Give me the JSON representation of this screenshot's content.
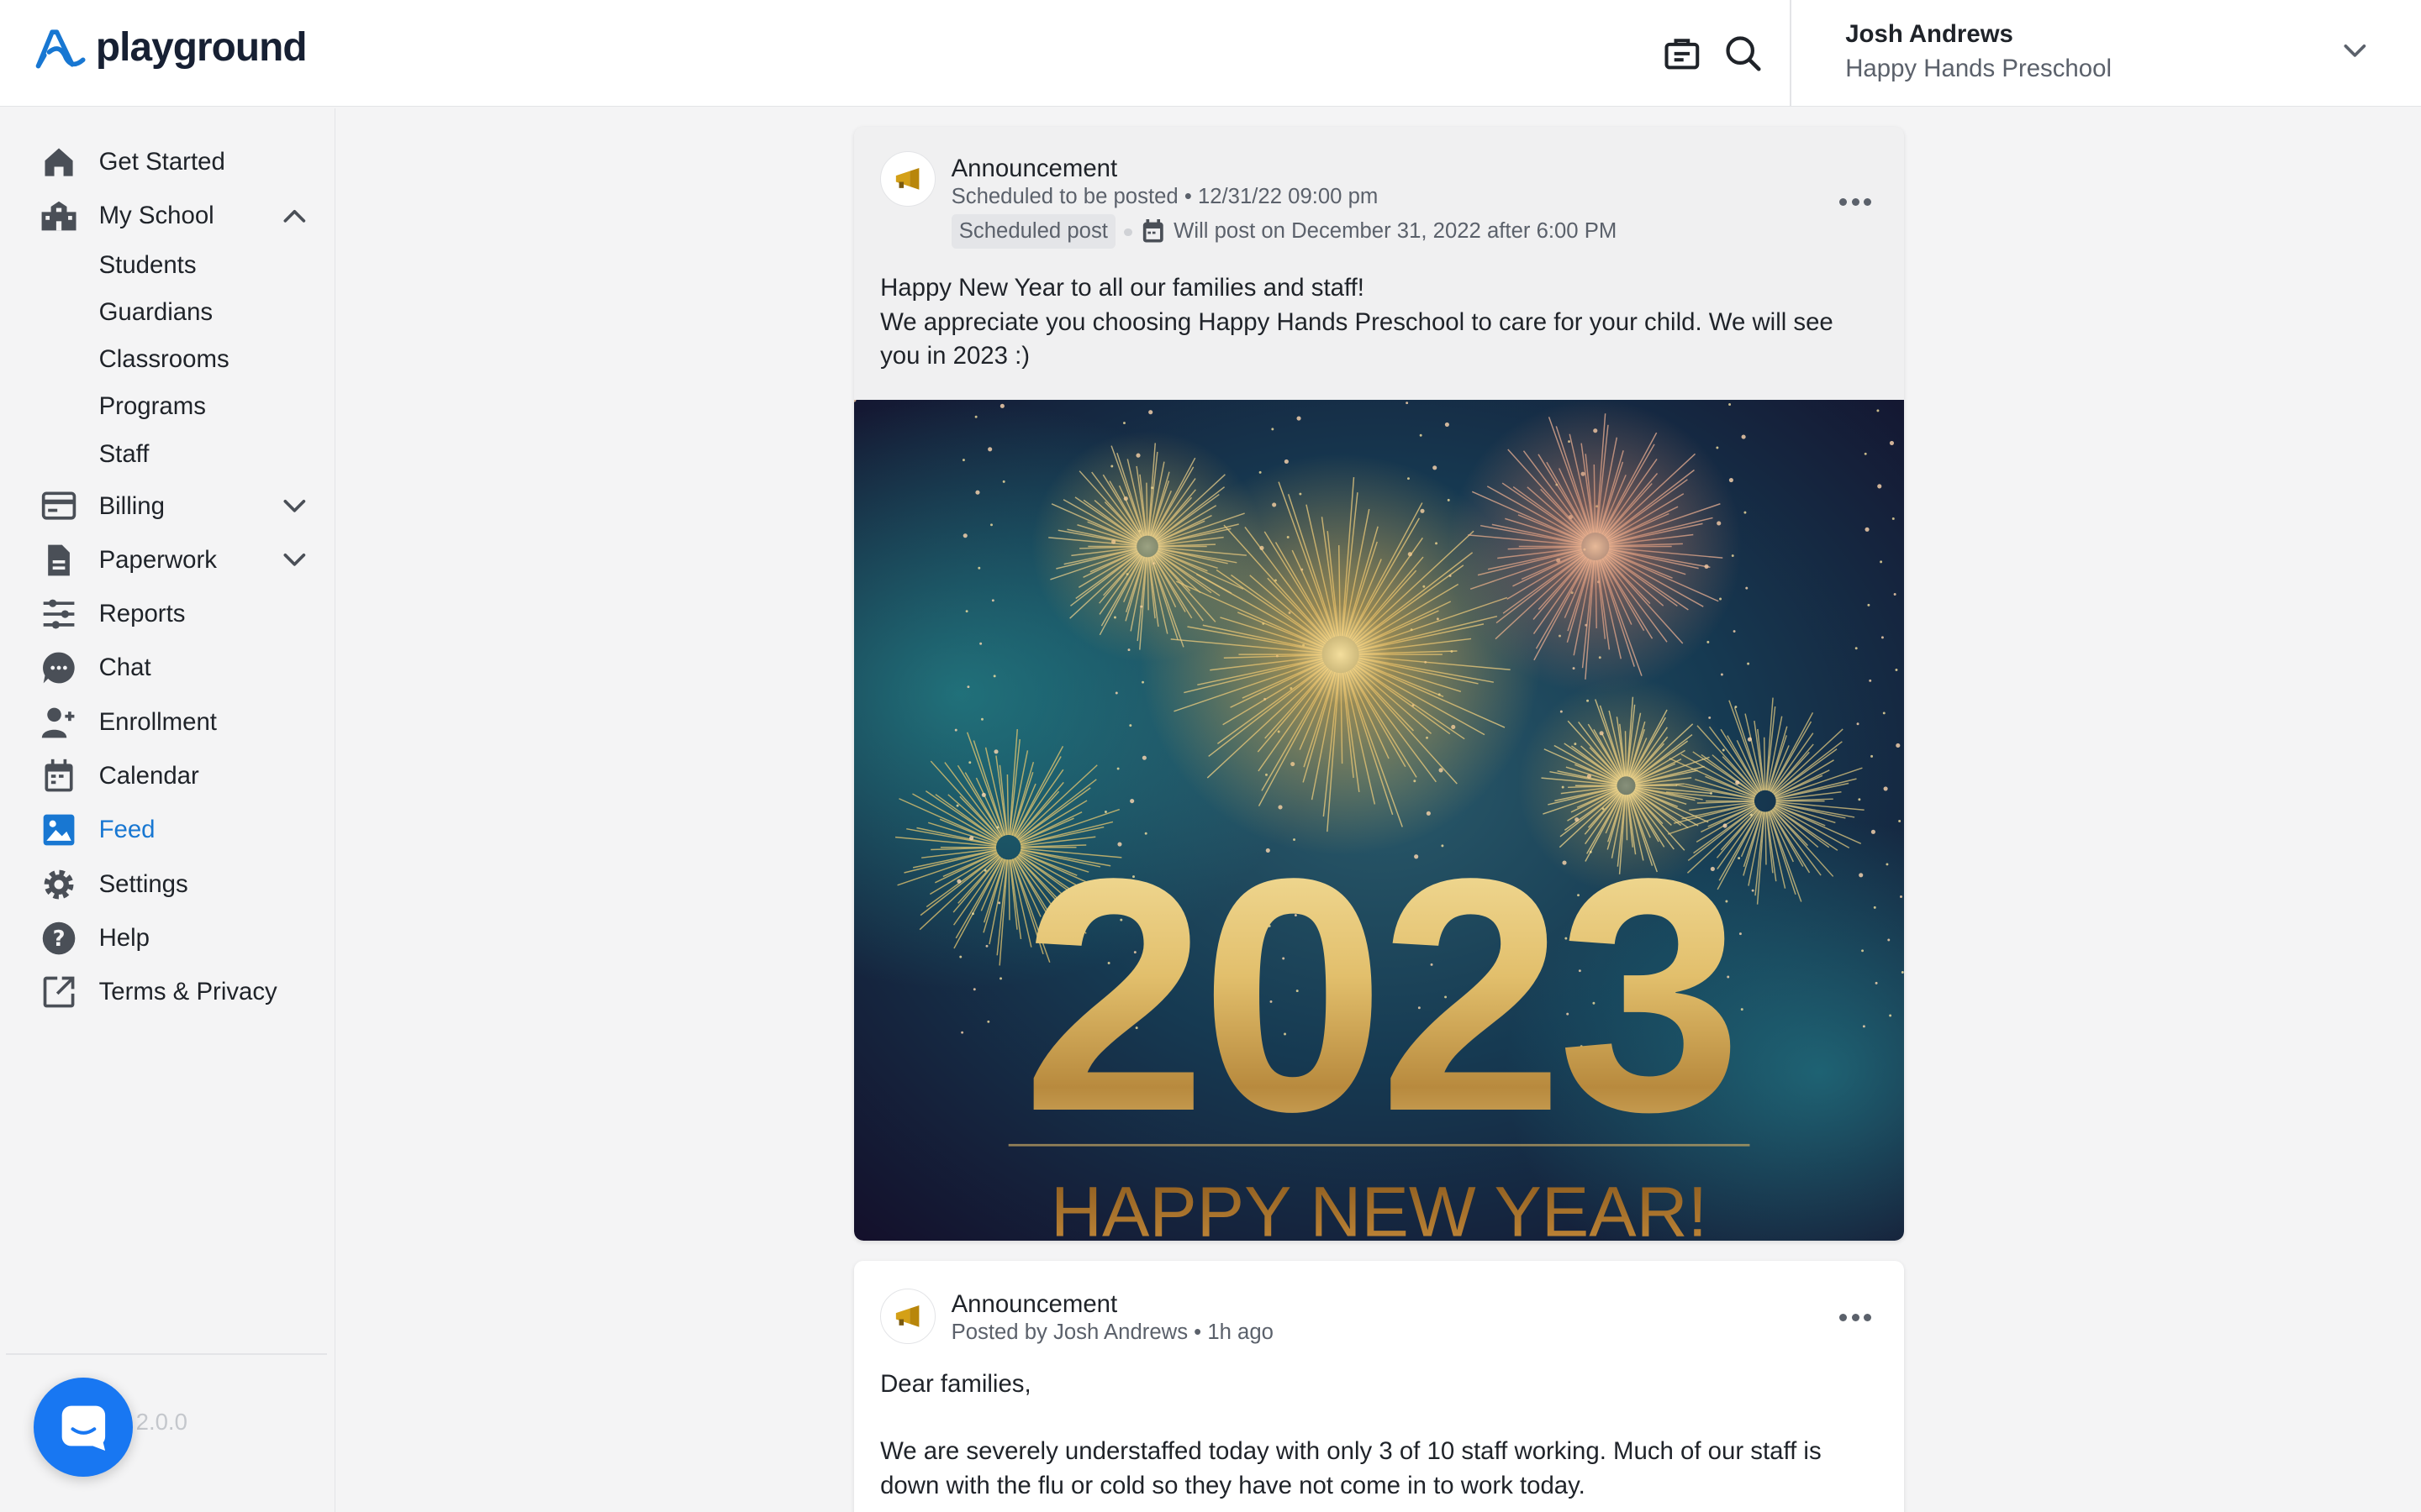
{
  "header": {
    "brand": "playground",
    "account": {
      "name": "Josh Andrews",
      "school": "Happy Hands Preschool"
    }
  },
  "sidebar": {
    "items": [
      {
        "label": "Get Started",
        "icon": "home-icon"
      },
      {
        "label": "My School",
        "icon": "school-icon",
        "expanded": true
      },
      {
        "label": "Billing",
        "icon": "billing-icon"
      },
      {
        "label": "Paperwork",
        "icon": "paperwork-icon"
      },
      {
        "label": "Reports",
        "icon": "reports-icon"
      },
      {
        "label": "Chat",
        "icon": "chat-icon"
      },
      {
        "label": "Enrollment",
        "icon": "enrollment-icon"
      },
      {
        "label": "Calendar",
        "icon": "calendar-icon"
      },
      {
        "label": "Feed",
        "icon": "feed-icon",
        "active": true
      },
      {
        "label": "Settings",
        "icon": "settings-icon"
      },
      {
        "label": "Help",
        "icon": "help-icon"
      },
      {
        "label": "Terms & Privacy",
        "icon": "external-link-icon"
      }
    ],
    "my_school_sub": [
      "Students",
      "Guardians",
      "Classrooms",
      "Programs",
      "Staff"
    ],
    "version": "2.0.0"
  },
  "feed": {
    "posts": [
      {
        "title": "Announcement",
        "meta": "Scheduled to be posted • 12/31/22 09:00 pm",
        "badge": "Scheduled post",
        "schedule": "Will post on December 31, 2022 after 6:00 PM",
        "body_line1": "Happy New Year to all our families and staff!",
        "body_line2": "We appreciate you choosing Happy Hands Preschool to care for your child. We will see you in 2023 :)",
        "image_year": "2023",
        "image_caption": "HAPPY NEW YEAR!"
      },
      {
        "title": "Announcement",
        "meta": "Posted by Josh Andrews • 1h ago",
        "body_line1": "Dear families,",
        "body_line2": "We are severely understaffed today with only 3 of 10 staff working. Much of our staff is down with the flu or cold so they have not come in to work today."
      }
    ]
  },
  "colors": {
    "accent": "#1877d2",
    "chat_bubble": "#1877f2",
    "text": "#1f2329",
    "muted": "#5b616b"
  }
}
